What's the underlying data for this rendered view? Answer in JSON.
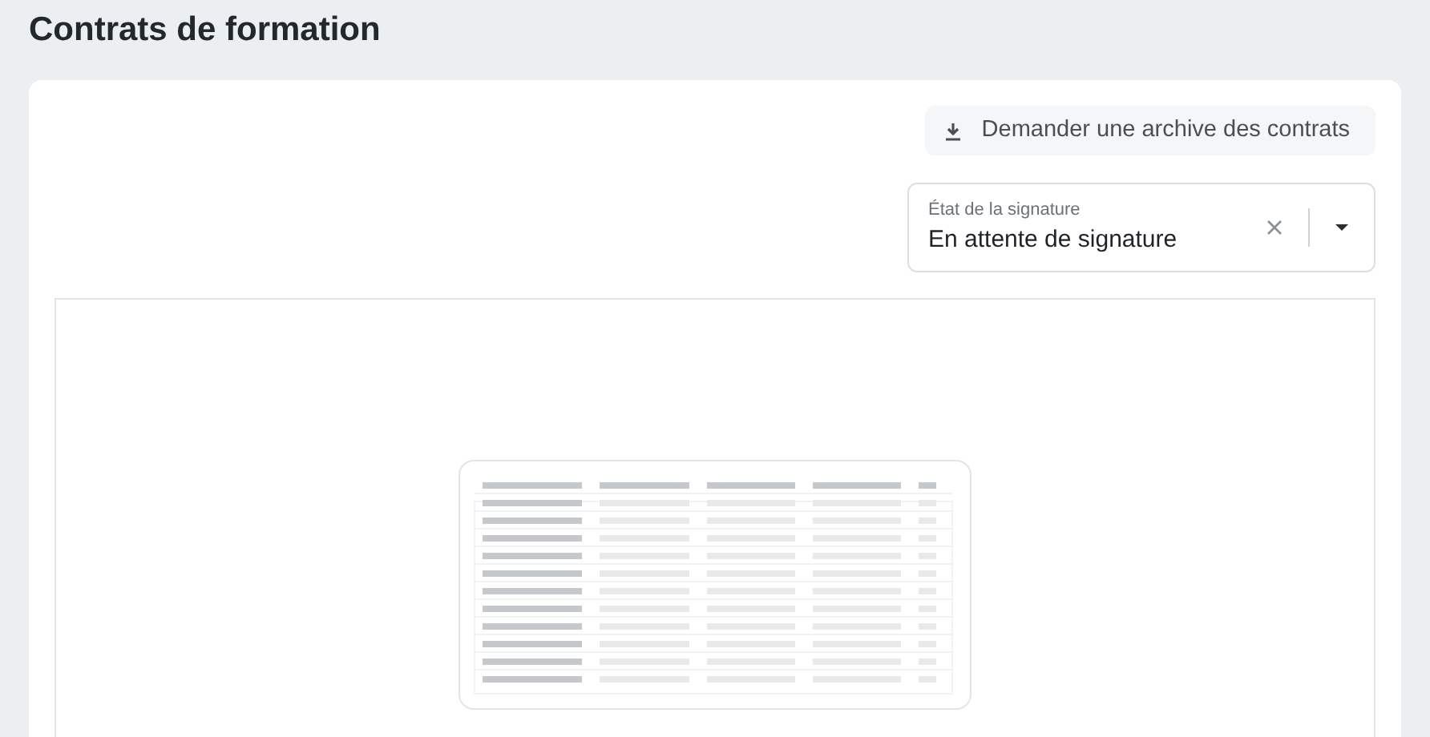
{
  "page": {
    "title": "Contrats de formation"
  },
  "archive_button": {
    "label": "Demander une archive des contrats"
  },
  "signature_filter": {
    "label": "État de la signature",
    "value": "En attente de signature"
  }
}
